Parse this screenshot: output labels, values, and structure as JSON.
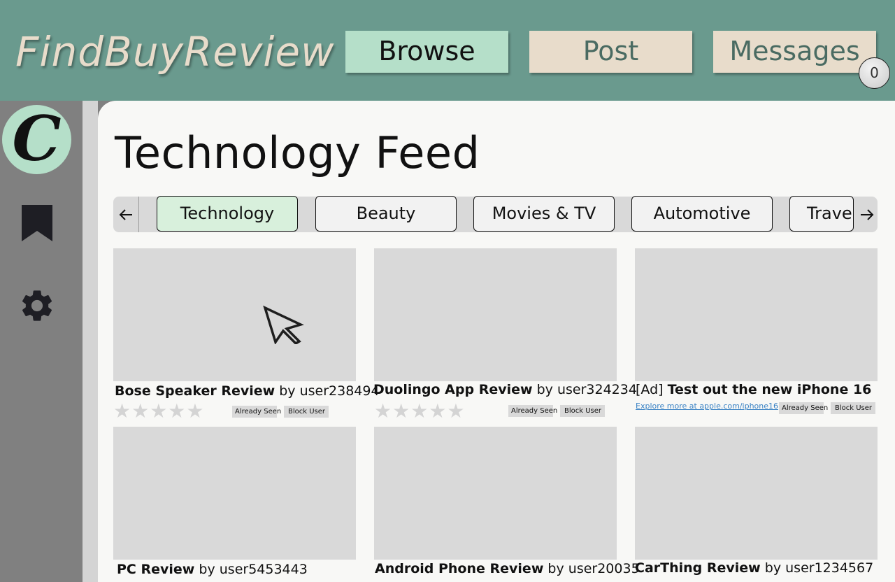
{
  "header": {
    "logo": "FindBuyReview",
    "nav": [
      {
        "label": "Browse",
        "active": true
      },
      {
        "label": "Post"
      },
      {
        "label": "Messages"
      }
    ],
    "message_count": "0"
  },
  "sidebar": {
    "avatar_letter": "C",
    "icons": [
      "bookmark-icon",
      "gear-icon"
    ]
  },
  "main": {
    "title": "Technology Feed",
    "tabs": [
      "Technology",
      "Beauty",
      "Movies & TV",
      "Automotive",
      "Travel"
    ],
    "active_tab": "Technology",
    "by_prefix": "by",
    "cards": [
      {
        "title": "Bose Speaker Review",
        "author": "user238494",
        "rating": 0,
        "stars": "★★★★★"
      },
      {
        "title": "Duolingo App Review",
        "author": "user324234",
        "rating": 0,
        "stars": "★★★★★"
      },
      {
        "ad_tag": "[Ad]",
        "title": "Test out the new iPhone 16",
        "link": "Explore more at apple.com/iphone16"
      },
      {
        "title": "PC Review",
        "author": "user5453443"
      },
      {
        "title": "Android Phone Review",
        "author": "user20035"
      },
      {
        "title": "CarThing Review",
        "author": "user1234567"
      }
    ],
    "already_seen_label": "Already Seen",
    "block_user_label": "Block User"
  },
  "colors": {
    "header_bg": "#6a9a8e",
    "accent_green": "#b5dfc9",
    "beige": "#e8dccb",
    "link": "#3a82c4"
  }
}
